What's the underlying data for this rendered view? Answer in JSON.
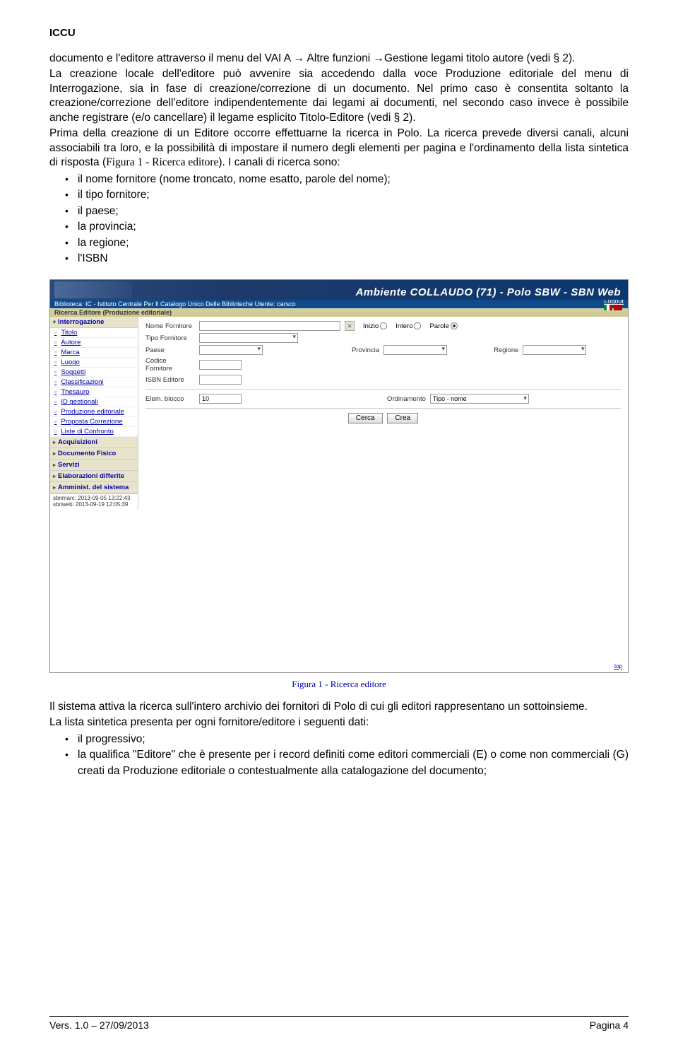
{
  "header": {
    "label": "ICCU"
  },
  "para1": "documento e l'editore attraverso il menu del VAI A → Altre funzioni →Gestione legami titolo autore (vedi § 2).",
  "para2": "La creazione locale dell'editore può avvenire sia accedendo dalla voce Produzione editoriale del menu di Interrogazione, sia in fase di creazione/correzione di un documento. Nel primo caso è consentita soltanto la creazione/correzione dell'editore indipendentemente dai legami ai documenti, nel secondo caso invece è possibile anche registrare (e/o cancellare) il legame esplicito Titolo-Editore (vedi § 2).",
  "para3a": "Prima della creazione di un Editore occorre effettuarne la ricerca in Polo. La ricerca prevede diversi canali, alcuni associabili tra loro, e la possibilità di impostare il numero degli elementi per pagina e l'ordinamento della lista sintetica di risposta (",
  "para3b": "Figura 1 - Ricerca editore",
  "para3c": "). I canali di ricerca sono:",
  "bullets1": [
    "il nome fornitore (nome troncato, nome esatto, parole del nome);",
    "il tipo fornitore;",
    "il paese;",
    "la provincia;",
    "la regione;",
    "l'ISBN"
  ],
  "screenshot": {
    "banner_title": "Ambiente COLLAUDO (71) - Polo SBW - SBN Web",
    "bar2_left": "Biblioteca: IC - Istituto Centrale Per Il Catalogo Unico Delle Biblioteche  Utente: carsco",
    "bar2_right": "Logout",
    "bar3": "Ricerca Editore (Produzione editoriale)",
    "sidebar": {
      "section1": "Interrogazione",
      "items1": [
        "Titolo",
        "Autore",
        "Marca",
        "Luogo",
        "Soggetti",
        "Classificazioni",
        "Thesauro",
        "ID gestionali",
        "Produzione editoriale",
        "Proposta Correzione",
        "Liste di Confronto"
      ],
      "sections_rest": [
        "Acquisizioni",
        "Documento Fisico",
        "Servizi",
        "Elaborazioni differite",
        "Amminist. del sistema"
      ],
      "footer1": "sbnmarc: 2013-09-05 13:22:43",
      "footer2": "sbnweb: 2013-09-19 12:05:39"
    },
    "form": {
      "nome_fornitore": "Nome Fornitore",
      "inizio": "Inizio",
      "intero": "Intero",
      "parole": "Parole",
      "tipo_fornitore": "Tipo Fornitore",
      "paese": "Paese",
      "provincia": "Provincia",
      "regione": "Regione",
      "codice_fornitore": "Codice Fornitore",
      "isbn": "ISBN Editore",
      "elem_blocco": "Elem. blocco",
      "elem_blocco_val": "10",
      "ordinamento": "Ordinamento",
      "ordinamento_val": "Tipo - nome",
      "btn_cerca": "Cerca",
      "btn_crea": "Crea",
      "top": "top"
    }
  },
  "caption": "Figura 1 - Ricerca editore",
  "para4": "Il sistema attiva la ricerca sull'intero archivio dei fornitori di Polo di cui gli editori rappresentano un sottoinsieme.",
  "para5": "La lista sintetica presenta per ogni fornitore/editore i seguenti dati:",
  "bullets2": [
    "il progressivo;",
    "la qualifica \"Editore\" che è presente per i record definiti come editori commerciali (E) o come non commerciali (G) creati da Produzione editoriale o contestualmente alla catalogazione del documento;"
  ],
  "footer": {
    "left": "Vers. 1.0 – 27/09/2013",
    "right": "Pagina 4"
  }
}
